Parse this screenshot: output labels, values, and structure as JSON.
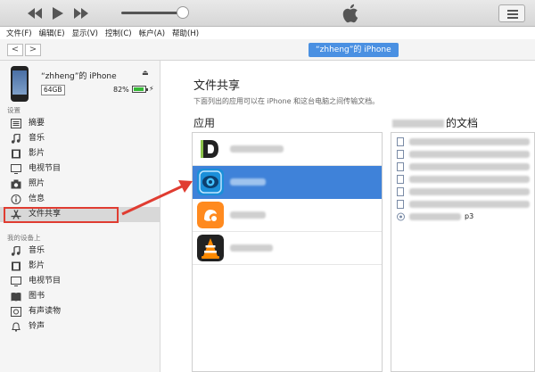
{
  "menu": [
    "文件(F)",
    "编辑(E)",
    "显示(V)",
    "控制(C)",
    "帐户(A)",
    "帮助(H)"
  ],
  "nav": {
    "back": "<",
    "forward": ">"
  },
  "device_pill": "“zhheng”的 iPhone",
  "device": {
    "name": "“zhheng”的 iPhone",
    "capacity": "64GB",
    "battery": "82%",
    "battery_level": 0.82
  },
  "sections": {
    "settings": "设置",
    "on_device": "我的设备上"
  },
  "settings_items": [
    "摘要",
    "音乐",
    "影片",
    "电视节目",
    "照片",
    "信息",
    "文件共享"
  ],
  "device_items": [
    "音乐",
    "影片",
    "电视节目",
    "图书",
    "有声读物",
    "铃声"
  ],
  "main": {
    "title": "文件共享",
    "subtitle": "下面列出的应用可以在 iPhone 和这台电脑之间传输文档。",
    "apps_header": "应用",
    "docs_header": "的文档",
    "doc_visible_suffix": "p3"
  },
  "colors": {
    "selection": "#3f82d9",
    "pill": "#4a90e2",
    "highlight": "#e03c31"
  }
}
